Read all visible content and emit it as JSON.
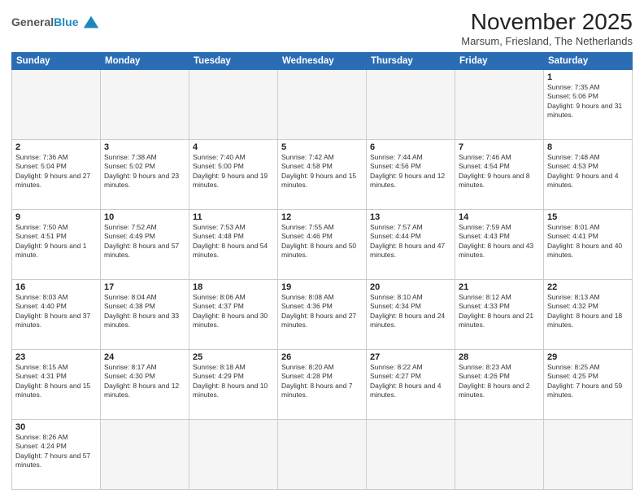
{
  "header": {
    "logo": {
      "general": "General",
      "blue": "Blue"
    },
    "title": "November 2025",
    "subtitle": "Marsum, Friesland, The Netherlands"
  },
  "weekdays": [
    "Sunday",
    "Monday",
    "Tuesday",
    "Wednesday",
    "Thursday",
    "Friday",
    "Saturday"
  ],
  "weeks": [
    [
      {
        "day": "",
        "info": "",
        "empty": true
      },
      {
        "day": "",
        "info": "",
        "empty": true
      },
      {
        "day": "",
        "info": "",
        "empty": true
      },
      {
        "day": "",
        "info": "",
        "empty": true
      },
      {
        "day": "",
        "info": "",
        "empty": true
      },
      {
        "day": "",
        "info": "",
        "empty": true
      },
      {
        "day": "1",
        "info": "Sunrise: 7:35 AM\nSunset: 5:06 PM\nDaylight: 9 hours and 31 minutes."
      }
    ],
    [
      {
        "day": "2",
        "info": "Sunrise: 7:36 AM\nSunset: 5:04 PM\nDaylight: 9 hours and 27 minutes."
      },
      {
        "day": "3",
        "info": "Sunrise: 7:38 AM\nSunset: 5:02 PM\nDaylight: 9 hours and 23 minutes."
      },
      {
        "day": "4",
        "info": "Sunrise: 7:40 AM\nSunset: 5:00 PM\nDaylight: 9 hours and 19 minutes."
      },
      {
        "day": "5",
        "info": "Sunrise: 7:42 AM\nSunset: 4:58 PM\nDaylight: 9 hours and 15 minutes."
      },
      {
        "day": "6",
        "info": "Sunrise: 7:44 AM\nSunset: 4:56 PM\nDaylight: 9 hours and 12 minutes."
      },
      {
        "day": "7",
        "info": "Sunrise: 7:46 AM\nSunset: 4:54 PM\nDaylight: 9 hours and 8 minutes."
      },
      {
        "day": "8",
        "info": "Sunrise: 7:48 AM\nSunset: 4:53 PM\nDaylight: 9 hours and 4 minutes."
      }
    ],
    [
      {
        "day": "9",
        "info": "Sunrise: 7:50 AM\nSunset: 4:51 PM\nDaylight: 9 hours and 1 minute."
      },
      {
        "day": "10",
        "info": "Sunrise: 7:52 AM\nSunset: 4:49 PM\nDaylight: 8 hours and 57 minutes."
      },
      {
        "day": "11",
        "info": "Sunrise: 7:53 AM\nSunset: 4:48 PM\nDaylight: 8 hours and 54 minutes."
      },
      {
        "day": "12",
        "info": "Sunrise: 7:55 AM\nSunset: 4:46 PM\nDaylight: 8 hours and 50 minutes."
      },
      {
        "day": "13",
        "info": "Sunrise: 7:57 AM\nSunset: 4:44 PM\nDaylight: 8 hours and 47 minutes."
      },
      {
        "day": "14",
        "info": "Sunrise: 7:59 AM\nSunset: 4:43 PM\nDaylight: 8 hours and 43 minutes."
      },
      {
        "day": "15",
        "info": "Sunrise: 8:01 AM\nSunset: 4:41 PM\nDaylight: 8 hours and 40 minutes."
      }
    ],
    [
      {
        "day": "16",
        "info": "Sunrise: 8:03 AM\nSunset: 4:40 PM\nDaylight: 8 hours and 37 minutes."
      },
      {
        "day": "17",
        "info": "Sunrise: 8:04 AM\nSunset: 4:38 PM\nDaylight: 8 hours and 33 minutes."
      },
      {
        "day": "18",
        "info": "Sunrise: 8:06 AM\nSunset: 4:37 PM\nDaylight: 8 hours and 30 minutes."
      },
      {
        "day": "19",
        "info": "Sunrise: 8:08 AM\nSunset: 4:36 PM\nDaylight: 8 hours and 27 minutes."
      },
      {
        "day": "20",
        "info": "Sunrise: 8:10 AM\nSunset: 4:34 PM\nDaylight: 8 hours and 24 minutes."
      },
      {
        "day": "21",
        "info": "Sunrise: 8:12 AM\nSunset: 4:33 PM\nDaylight: 8 hours and 21 minutes."
      },
      {
        "day": "22",
        "info": "Sunrise: 8:13 AM\nSunset: 4:32 PM\nDaylight: 8 hours and 18 minutes."
      }
    ],
    [
      {
        "day": "23",
        "info": "Sunrise: 8:15 AM\nSunset: 4:31 PM\nDaylight: 8 hours and 15 minutes."
      },
      {
        "day": "24",
        "info": "Sunrise: 8:17 AM\nSunset: 4:30 PM\nDaylight: 8 hours and 12 minutes."
      },
      {
        "day": "25",
        "info": "Sunrise: 8:18 AM\nSunset: 4:29 PM\nDaylight: 8 hours and 10 minutes."
      },
      {
        "day": "26",
        "info": "Sunrise: 8:20 AM\nSunset: 4:28 PM\nDaylight: 8 hours and 7 minutes."
      },
      {
        "day": "27",
        "info": "Sunrise: 8:22 AM\nSunset: 4:27 PM\nDaylight: 8 hours and 4 minutes."
      },
      {
        "day": "28",
        "info": "Sunrise: 8:23 AM\nSunset: 4:26 PM\nDaylight: 8 hours and 2 minutes."
      },
      {
        "day": "29",
        "info": "Sunrise: 8:25 AM\nSunset: 4:25 PM\nDaylight: 7 hours and 59 minutes."
      }
    ],
    [
      {
        "day": "30",
        "info": "Sunrise: 8:26 AM\nSunset: 4:24 PM\nDaylight: 7 hours and 57 minutes."
      },
      {
        "day": "",
        "info": "",
        "empty": true
      },
      {
        "day": "",
        "info": "",
        "empty": true
      },
      {
        "day": "",
        "info": "",
        "empty": true
      },
      {
        "day": "",
        "info": "",
        "empty": true
      },
      {
        "day": "",
        "info": "",
        "empty": true
      },
      {
        "day": "",
        "info": "",
        "empty": true
      }
    ]
  ]
}
